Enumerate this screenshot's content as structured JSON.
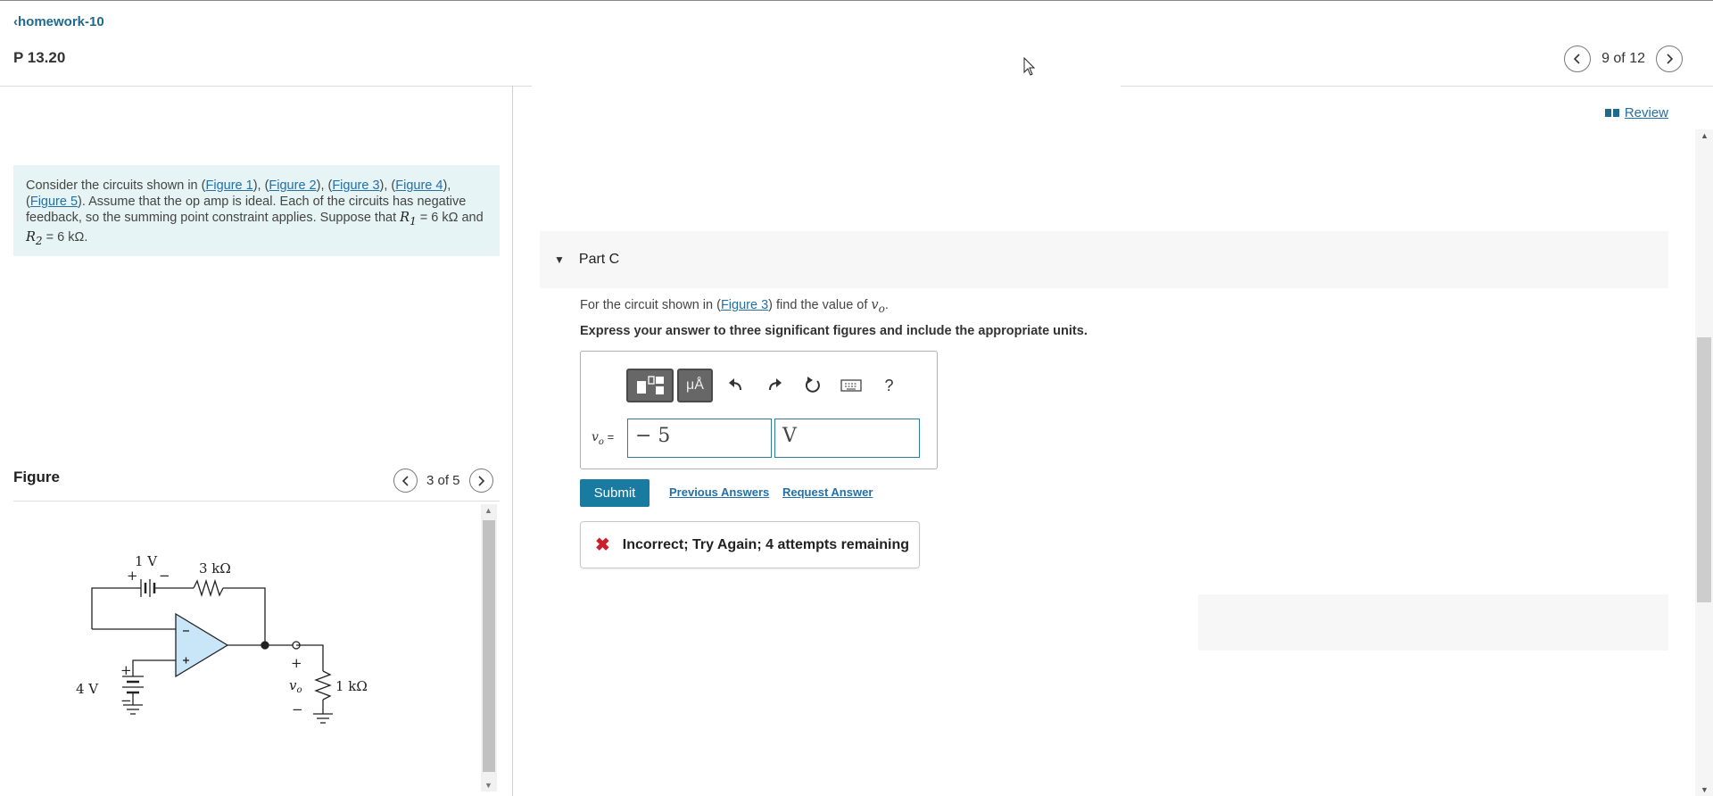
{
  "header": {
    "back_label": "homework-10",
    "problem_title": "P 13.20",
    "pager_text": "9 of 12",
    "review_label": "Review"
  },
  "problem": {
    "intro": "Consider the circuits shown in (",
    "links": [
      "Figure 1",
      "Figure 2",
      "Figure 3",
      "Figure 4",
      "Figure 5"
    ],
    "text_after": "). Assume that the op amp is ideal. Each of the circuits has negative feedback, so the summing point constraint applies. Suppose that ",
    "r1": "R",
    "r1_sub": "1",
    "r1_val": " = 6 kΩ",
    "and": " and ",
    "r2": "R",
    "r2_sub": "2",
    "r2_val": " = 6 kΩ."
  },
  "figure": {
    "label": "Figure",
    "pager_text": "3 of 5",
    "labels": {
      "source_top": "1 V",
      "resistor_top": "3 kΩ",
      "source_left": "4 V",
      "load": "1 kΩ",
      "vo": "v",
      "vo_sub": "o",
      "plus": "+",
      "minus": "−"
    }
  },
  "part": {
    "title": "Part C",
    "question_pre": "For the circuit shown in (",
    "question_link": "Figure 3",
    "question_post": ") find the value of ",
    "question_var": "v",
    "question_var_sub": "o",
    "instruction": "Express your answer to three significant figures and include the appropriate units.",
    "toolbar": {
      "templates": "templates",
      "units": "μÅ",
      "help": "?"
    },
    "answer_label": "v",
    "answer_label_sub": "o",
    "answer_eq": " =",
    "answer_value": "− 5",
    "answer_unit": "V",
    "submit": "Submit",
    "previous_answers": "Previous Answers",
    "request_answer": "Request Answer",
    "feedback": "Incorrect; Try Again; 4 attempts remaining"
  },
  "colors": {
    "accent": "#1a7ba0",
    "problem_bg": "#e6f4f6",
    "error": "#cc1f2d",
    "link": "#2370a7"
  }
}
